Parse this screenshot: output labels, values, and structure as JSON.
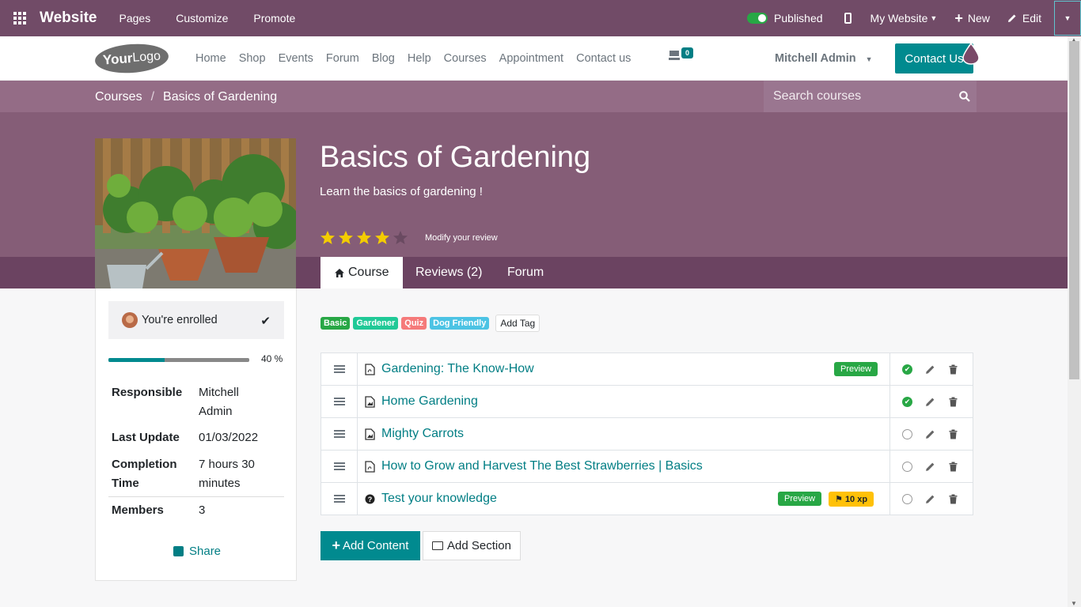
{
  "topbar": {
    "brand": "Website",
    "menus": [
      "Pages",
      "Customize",
      "Promote"
    ],
    "published": "Published",
    "my_website": "My Website",
    "new": "New",
    "edit": "Edit"
  },
  "header": {
    "logo_your": "Your",
    "logo_logo": "Logo",
    "nav": [
      "Home",
      "Shop",
      "Events",
      "Forum",
      "Blog",
      "Help",
      "Courses",
      "Appointment",
      "Contact us"
    ],
    "cart_count": "0",
    "user": "Mitchell Admin",
    "contact_button": "Contact Us"
  },
  "breadcrumb": {
    "parent": "Courses",
    "separator": "/",
    "current": "Basics of Gardening"
  },
  "search": {
    "placeholder": "Search courses"
  },
  "course": {
    "title": "Basics of Gardening",
    "description": "Learn the basics of gardening !",
    "rating": 4,
    "rating_max": 5,
    "review_link": "Modify your review"
  },
  "tabs": [
    "Course",
    "Reviews (2)",
    "Forum"
  ],
  "sidebar": {
    "enrolled": "You're enrolled",
    "progress_value": 0.4,
    "progress_label": "40 %",
    "info": {
      "responsible_key": "Responsible",
      "responsible_val1": "Mitchell",
      "responsible_val2": "Admin",
      "last_update_key": "Last Update",
      "last_update_val": "01/03/2022",
      "completion_key1": "Completion",
      "completion_key2": "Time",
      "completion_val1": "7 hours 30",
      "completion_val2": "minutes",
      "members_key": "Members",
      "members_val": "3"
    },
    "share": "Share"
  },
  "tags": [
    {
      "label": "Basic",
      "color": "#28a745"
    },
    {
      "label": "Gardener",
      "color": "#20c997"
    },
    {
      "label": "Quiz",
      "color": "#f57a7a"
    },
    {
      "label": "Dog Friendly",
      "color": "#4cc3e4"
    }
  ],
  "add_tag": "Add Tag",
  "content_rows": [
    {
      "title": "Gardening: The Know-How",
      "icon": "pdf-icon",
      "done": true,
      "preview": "Preview",
      "xp": ""
    },
    {
      "title": "Home Gardening",
      "icon": "image-icon",
      "done": true,
      "preview": "",
      "xp": ""
    },
    {
      "title": "Mighty Carrots",
      "icon": "image-icon",
      "done": false,
      "preview": "",
      "xp": ""
    },
    {
      "title": "How to Grow and Harvest The Best Strawberries | Basics",
      "icon": "pdf-icon",
      "done": false,
      "preview": "",
      "xp": ""
    },
    {
      "title": "Test your knowledge",
      "icon": "question-icon",
      "done": false,
      "preview": "Preview",
      "xp": "10 xp"
    }
  ],
  "buttons": {
    "add_content": "Add Content",
    "add_section": "Add Section"
  },
  "colors": {
    "primary": "#714b67",
    "accent": "#018a8f",
    "link": "#017e84"
  }
}
